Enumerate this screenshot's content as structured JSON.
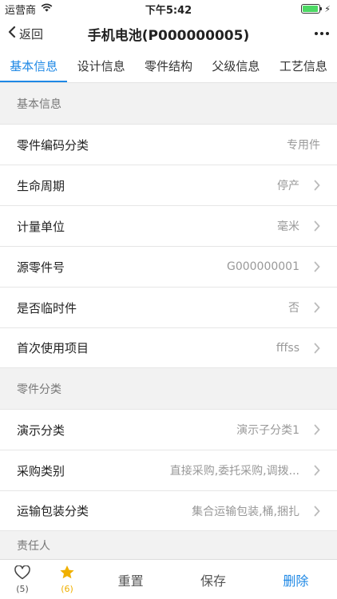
{
  "status": {
    "carrier": "运营商",
    "time": "下午5:42",
    "battery_level": 0.95
  },
  "nav": {
    "back_label": "返回",
    "title": "手机电池(P000000005)"
  },
  "tabs": [
    {
      "label": "基本信息",
      "active": true
    },
    {
      "label": "设计信息"
    },
    {
      "label": "零件结构"
    },
    {
      "label": "父级信息"
    },
    {
      "label": "工艺信息"
    }
  ],
  "sections": {
    "basic": {
      "title": "基本信息",
      "rows": [
        {
          "label": "零件编码分类",
          "value": "专用件"
        },
        {
          "label": "生命周期",
          "value": "停产"
        },
        {
          "label": "计量单位",
          "value": "毫米"
        },
        {
          "label": "源零件号",
          "value": "G000000001"
        },
        {
          "label": "是否临时件",
          "value": "否"
        },
        {
          "label": "首次使用项目",
          "value": "fffss"
        }
      ]
    },
    "classify": {
      "title": "零件分类",
      "rows": [
        {
          "label": "演示分类",
          "value": "演示子分类1"
        },
        {
          "label": "采购类别",
          "value": "直接采购,委托采购,调拨..."
        },
        {
          "label": "运输包装分类",
          "value": "集合运输包装,桶,捆扎"
        }
      ]
    },
    "responsible": {
      "title": "责任人"
    }
  },
  "bottom": {
    "like_count": "(5)",
    "star_count": "(6)",
    "reset_label": "重置",
    "save_label": "保存",
    "delete_label": "删除"
  },
  "colors": {
    "accent": "#1e88e5",
    "star": "#f0b000"
  }
}
